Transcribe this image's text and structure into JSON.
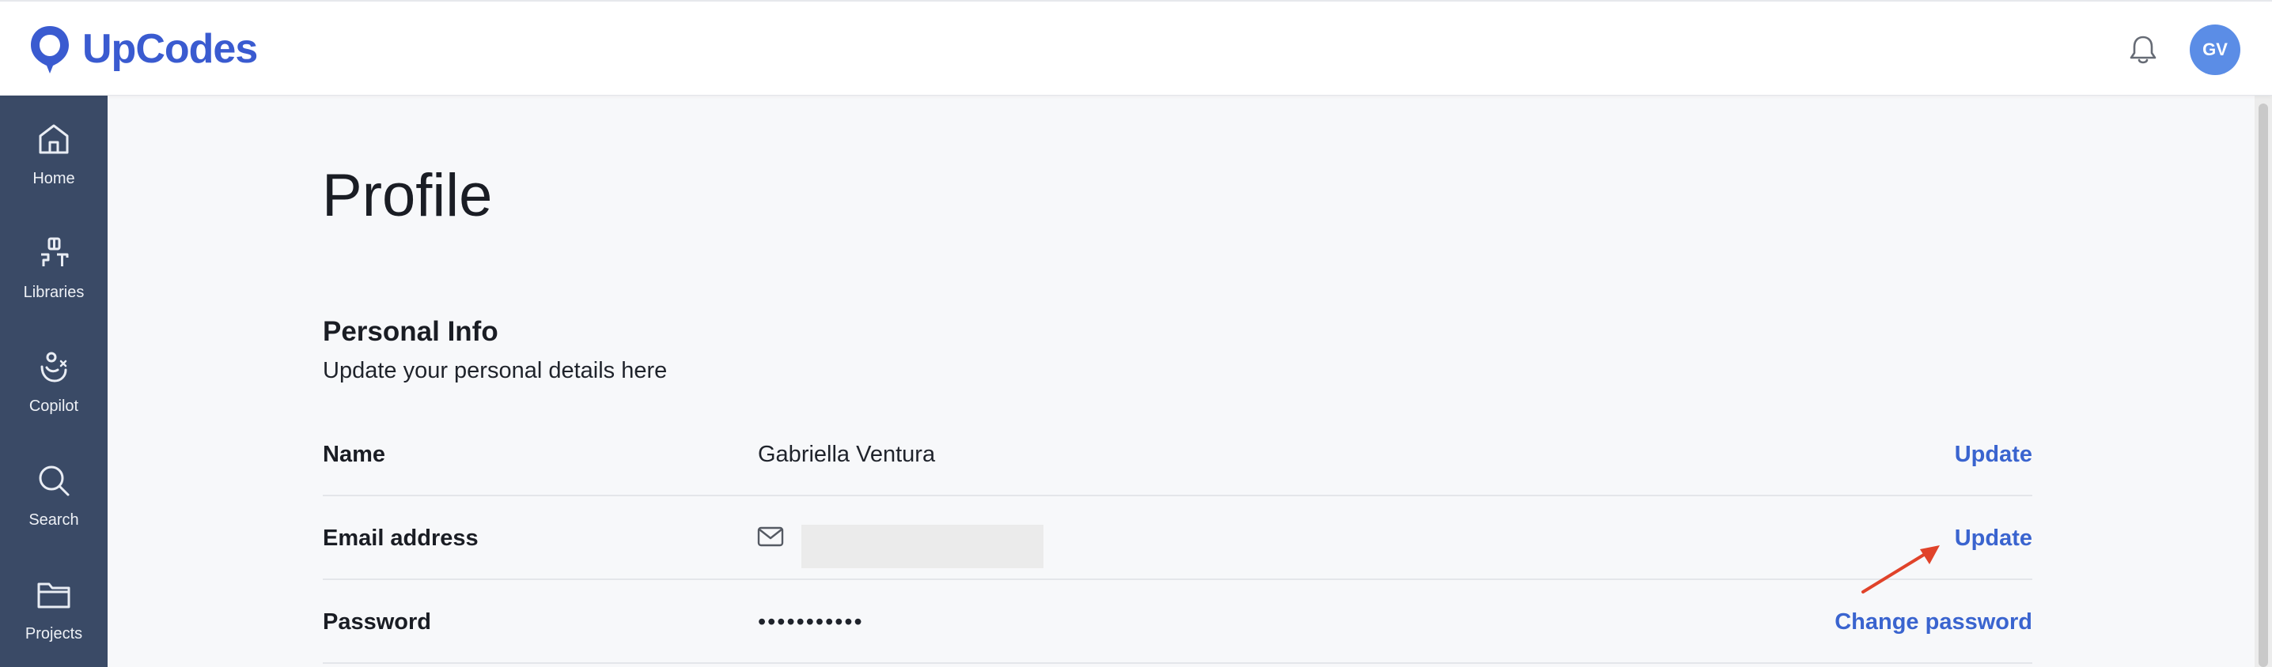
{
  "header": {
    "brand": "UpCodes",
    "brand_color": "#3a5bd0",
    "notification_icon": "bell-icon",
    "avatar_initials": "GV",
    "avatar_color": "#5b8de6"
  },
  "sidebar": {
    "background": "#3a4a66",
    "items": [
      {
        "label": "Home",
        "icon": "home-icon"
      },
      {
        "label": "Libraries",
        "icon": "libraries-icon"
      },
      {
        "label": "Copilot",
        "icon": "copilot-icon"
      },
      {
        "label": "Search",
        "icon": "search-icon"
      },
      {
        "label": "Projects",
        "icon": "folder-icon"
      }
    ]
  },
  "main": {
    "title": "Profile",
    "section": {
      "title": "Personal Info",
      "subtitle": "Update your personal details here"
    },
    "rows": [
      {
        "label": "Name",
        "value": "Gabriella Ventura",
        "action": "Update"
      },
      {
        "label": "Email address",
        "value": "",
        "value_icon": "mail-icon",
        "action": "Update"
      },
      {
        "label": "Password",
        "value": "•••••••••••",
        "action": "Change password"
      }
    ],
    "accent_color": "#3a64cf",
    "annotation_color": "#e0432a"
  }
}
